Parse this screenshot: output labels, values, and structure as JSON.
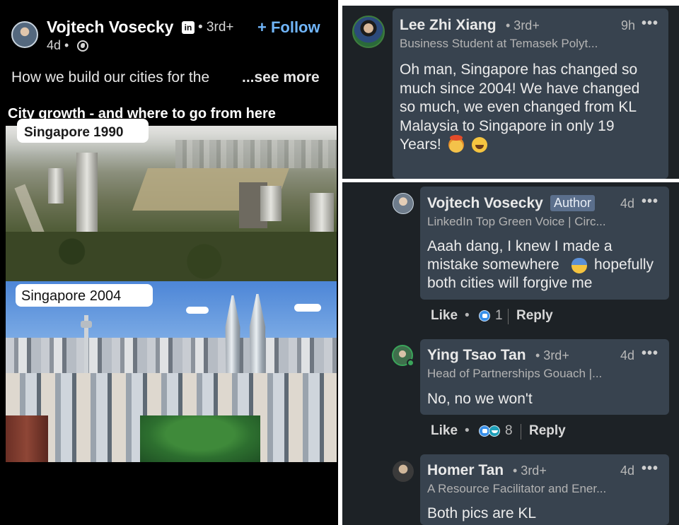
{
  "post": {
    "author_name": "Vojtech Vosecky",
    "linkedin_badge": "in",
    "degree": "• 3rd+",
    "follow_label": "+ Follow",
    "time": "4d •",
    "globe_icon": "globe-icon",
    "text": "How we build our cities for the",
    "see_more": "...see more",
    "document_title": "City growth - and where to go from here",
    "image_1_label": "Singapore  1990",
    "image_2_label": "Singapore  2004"
  },
  "comments": [
    {
      "name": "Lee Zhi Xiang",
      "degree": "• 3rd+",
      "time": "9h",
      "more": "•••",
      "headline": "Business Student at Temasek Polyt...",
      "body_lines": [
        "Oh man, Singapore has changed so",
        "much since 2004! We have changed",
        "so much, we even changed from KL",
        "Malaysia to Singapore in only 19",
        "Years!"
      ],
      "emojis": [
        "exploding-head",
        "tears-of-joy"
      ]
    },
    {
      "name": "Vojtech Vosecky",
      "badge": "Author",
      "time": "4d",
      "more": "•••",
      "headline": "LinkedIn Top Green Voice | Circ...",
      "body_lines": [
        "Aaah dang, I knew I made a",
        "mistake somewhere",
        "hopefully",
        "both cities will forgive me"
      ],
      "emojis": [
        "downcast-sweat"
      ],
      "like_label": "Like",
      "dot": "•",
      "reaction_count": "1",
      "reply_label": "Reply"
    },
    {
      "name": "Ying Tsao Tan",
      "degree": "• 3rd+",
      "time": "4d",
      "more": "•••",
      "headline": "Head of Partnerships Gouach |...",
      "body_lines": [
        "No, no we won't"
      ],
      "like_label": "Like",
      "dot": "•",
      "reaction_count": "8",
      "reply_label": "Reply"
    },
    {
      "name": "Homer Tan",
      "degree": "• 3rd+",
      "time": "4d",
      "more": "•••",
      "headline": "A Resource Facilitator and Ener...",
      "body_lines": [
        "Both pics are KL"
      ]
    }
  ],
  "colors": {
    "background_dark": "#000000",
    "comment_panel": "#1d2226",
    "bubble": "#38434f",
    "follow_blue": "#70b5f9",
    "author_badge": "#5b6f8c"
  }
}
